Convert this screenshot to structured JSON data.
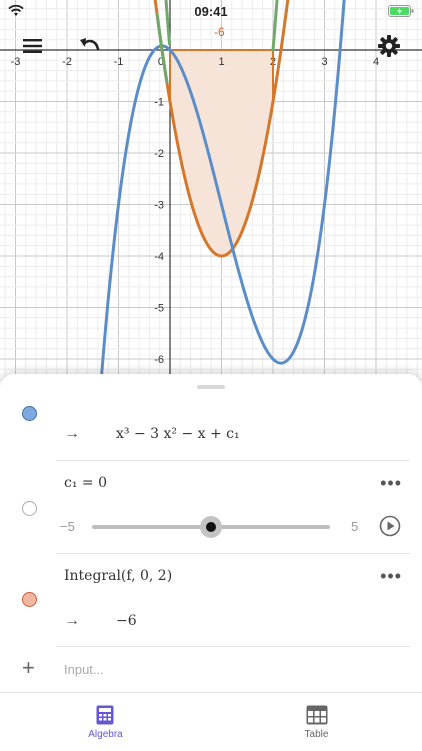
{
  "status": {
    "time": "09:41"
  },
  "graph": {
    "x_ticks": [
      "-3",
      "-2",
      "-1",
      "0",
      "1",
      "2",
      "3",
      "4"
    ],
    "y_ticks": [
      "-1",
      "-2",
      "-3",
      "-4",
      "-5",
      "-6"
    ],
    "integral_value_label": "-6",
    "colors": {
      "cubic": "#5b8ec9",
      "parabola": "#d4772b",
      "green": "#6fa86a",
      "fill": "#f7e4d8"
    }
  },
  "algebra": {
    "items": [
      {
        "arrow": "→",
        "expression": "x³ − 3 x² − x + c₁"
      },
      {
        "label": "c₁  =  0",
        "slider_min": "−5",
        "slider_max": "5",
        "slider_value": 0
      },
      {
        "label": "Integral(f, 0, 2)",
        "arrow": "→",
        "result": "−6"
      }
    ],
    "input_placeholder": "Input..."
  },
  "tabs": [
    {
      "label": "Algebra",
      "icon": "calculator-icon",
      "active": true
    },
    {
      "label": "Table",
      "icon": "table-icon",
      "active": false
    }
  ]
}
